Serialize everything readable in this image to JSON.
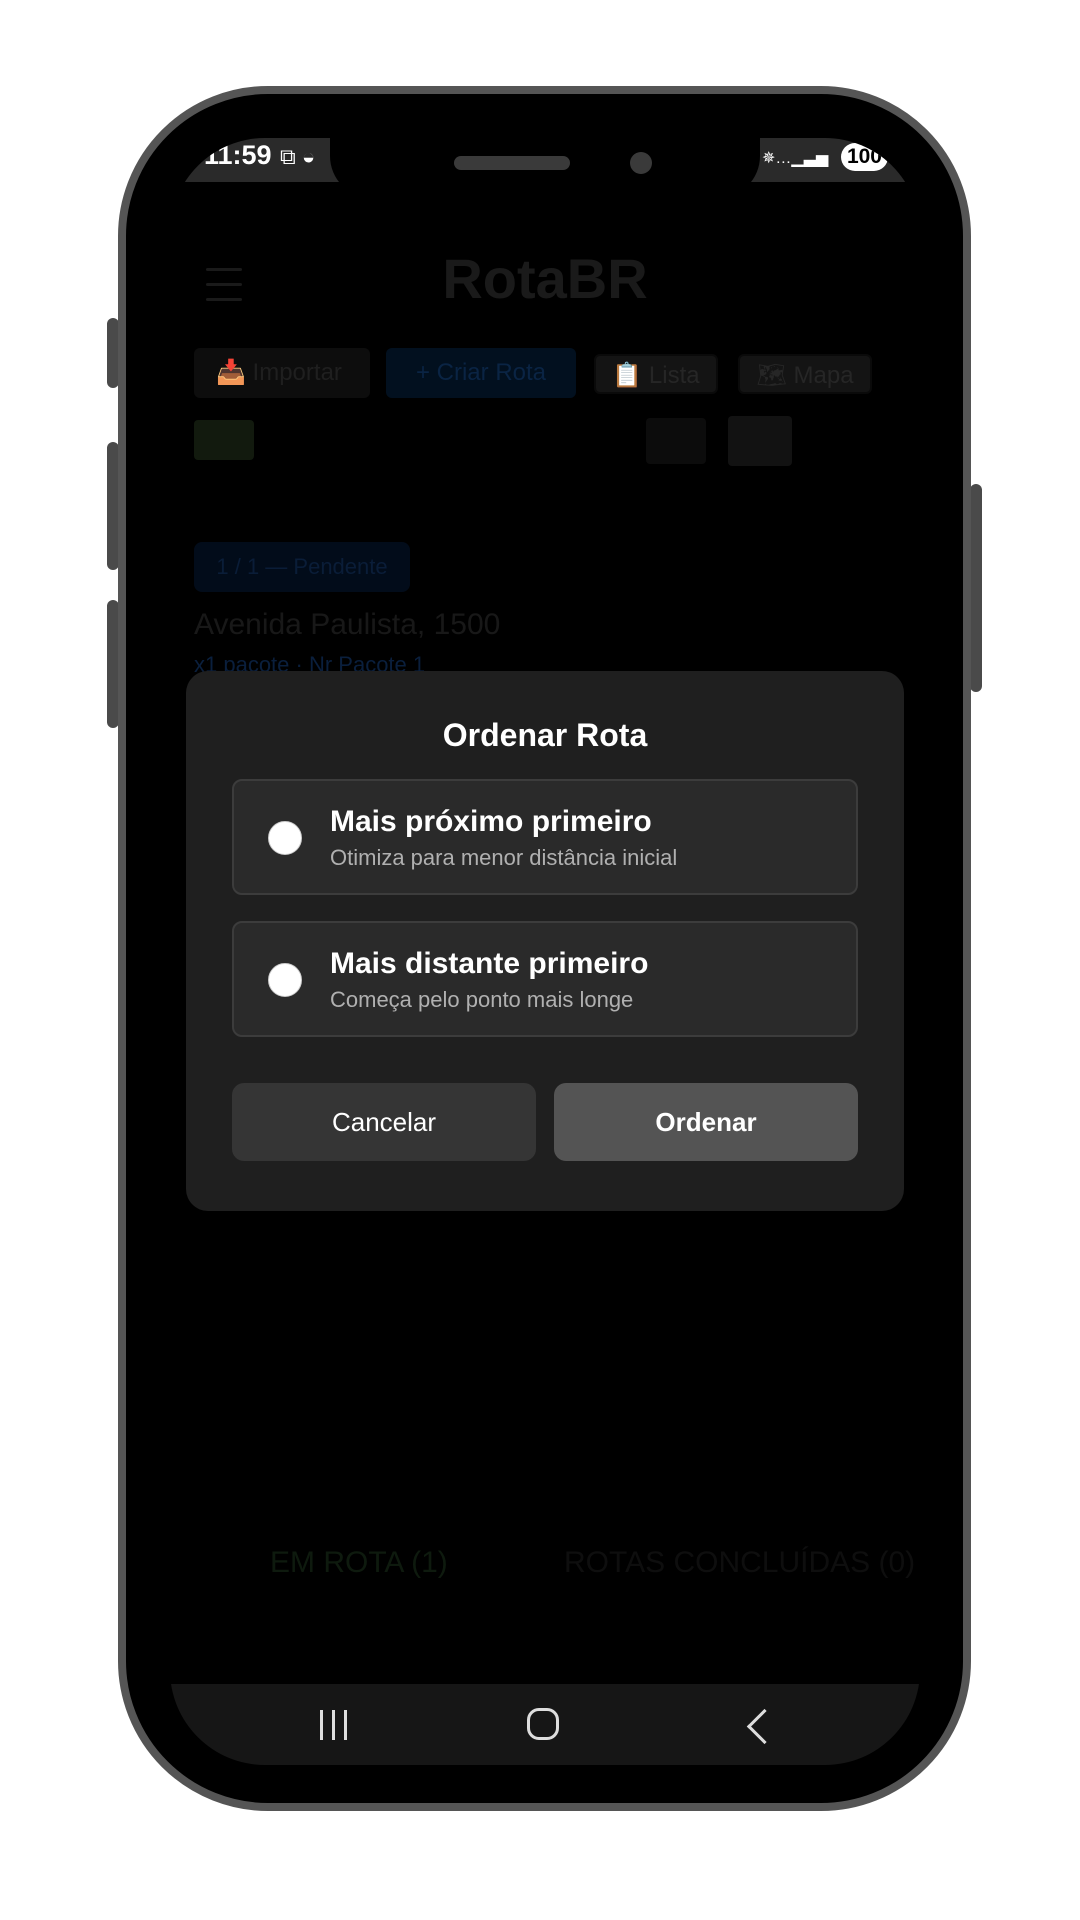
{
  "status_bar": {
    "time": "11:59",
    "left_icons": "⧉ ◒",
    "signal": "✵…▁▃▅",
    "battery": "100"
  },
  "background_app": {
    "title": "RotaBR",
    "toolbar": {
      "import_label": "📥 Importar",
      "create_route_label": "+ Criar Rota",
      "list_label": "📋 Lista",
      "map_label": "🗺 Mapa"
    },
    "stop": {
      "badge": "1 / 1 — Pendente",
      "address": "Avenida Paulista, 1500",
      "package": "x1 pacote · Nr Pacote 1"
    },
    "tabs": [
      {
        "label": "EM ROTA (1)"
      },
      {
        "label": "ROTAS CONCLUÍDAS (0)"
      }
    ]
  },
  "modal": {
    "title": "Ordenar Rota",
    "options": [
      {
        "title": "Mais próximo primeiro",
        "subtitle": "Otimiza para menor distância inicial"
      },
      {
        "title": "Mais distante primeiro",
        "subtitle": "Começa pelo ponto mais longe"
      }
    ],
    "cancel_label": "Cancelar",
    "confirm_label": "Ordenar"
  },
  "nav_bar": {
    "recents_icon": "recents-icon",
    "home_icon": "home-icon",
    "back_icon": "back-icon"
  }
}
